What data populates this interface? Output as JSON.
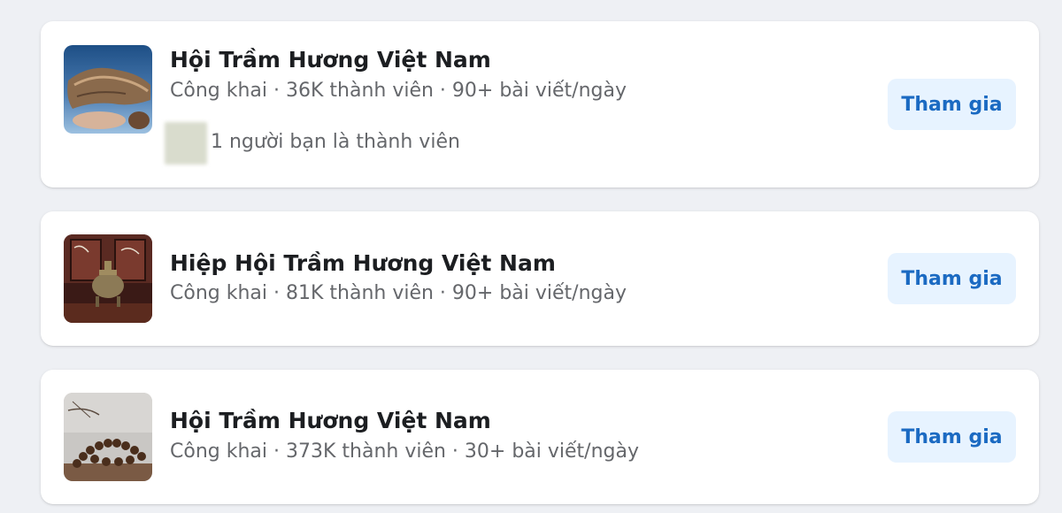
{
  "groups": [
    {
      "name": "Hội Trầm Hương Việt Nam",
      "meta": "Công khai · 36K thành viên · 90+ bài viết/ngày",
      "friends_text": "1 người bạn là thành viên",
      "join_label": "Tham gia"
    },
    {
      "name": "Hiệp Hội Trầm Hương Việt Nam",
      "meta": "Công khai · 81K thành viên · 90+ bài viết/ngày",
      "join_label": "Tham gia"
    },
    {
      "name": "Hội Trầm Hương Việt Nam",
      "meta": "Công khai · 373K thành viên · 30+ bài viết/ngày",
      "join_label": "Tham gia"
    }
  ],
  "colors": {
    "page_background": "#eef0f4",
    "card_background": "#ffffff",
    "join_button_bg": "#e7f3ff",
    "join_button_text": "#1b6ac2",
    "primary_text": "#1c1e21",
    "secondary_text": "#65676b"
  }
}
